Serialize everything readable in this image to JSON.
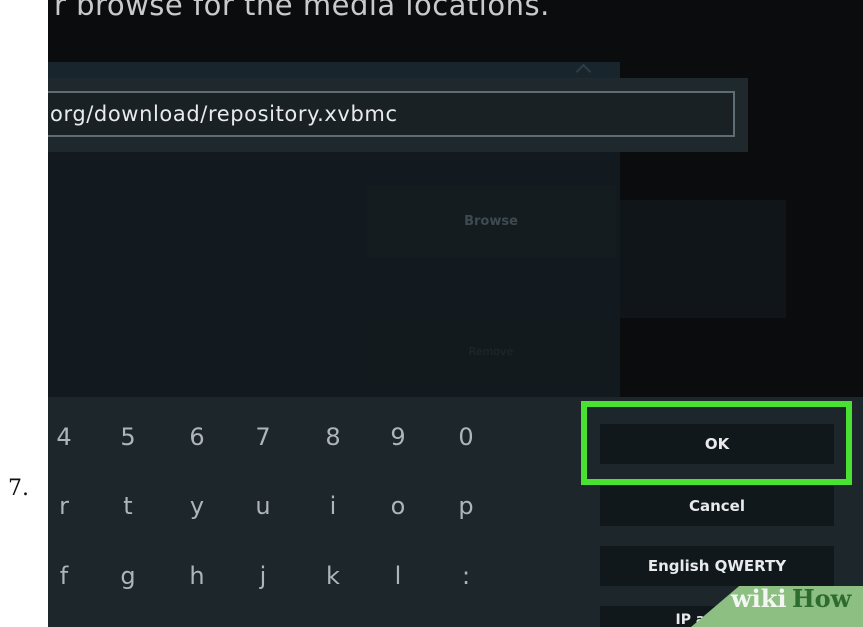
{
  "step_number": "7.",
  "dialog": {
    "heading": "r browse for the media locations.",
    "url_value": "org/download/repository.xvbmc",
    "browse_label": "Browse",
    "faded_label": "Remove"
  },
  "keyboard": {
    "rows": [
      [
        "4",
        "5",
        "6",
        "7",
        "8",
        "9",
        "0"
      ],
      [
        "r",
        "t",
        "y",
        "u",
        "i",
        "o",
        "p"
      ],
      [
        "f",
        "g",
        "h",
        "j",
        "k",
        "l",
        ":"
      ]
    ]
  },
  "actions": {
    "ok_label": "OK",
    "cancel_label": "Cancel",
    "layout_label": "English QWERTY",
    "ip_label": "IP address"
  },
  "watermark": {
    "wiki": "wiki",
    "how": "How"
  },
  "colors": {
    "highlight": "#4ae232",
    "screen_bg": "#0b0c0d",
    "keyboard_bg": "#1c262b"
  }
}
